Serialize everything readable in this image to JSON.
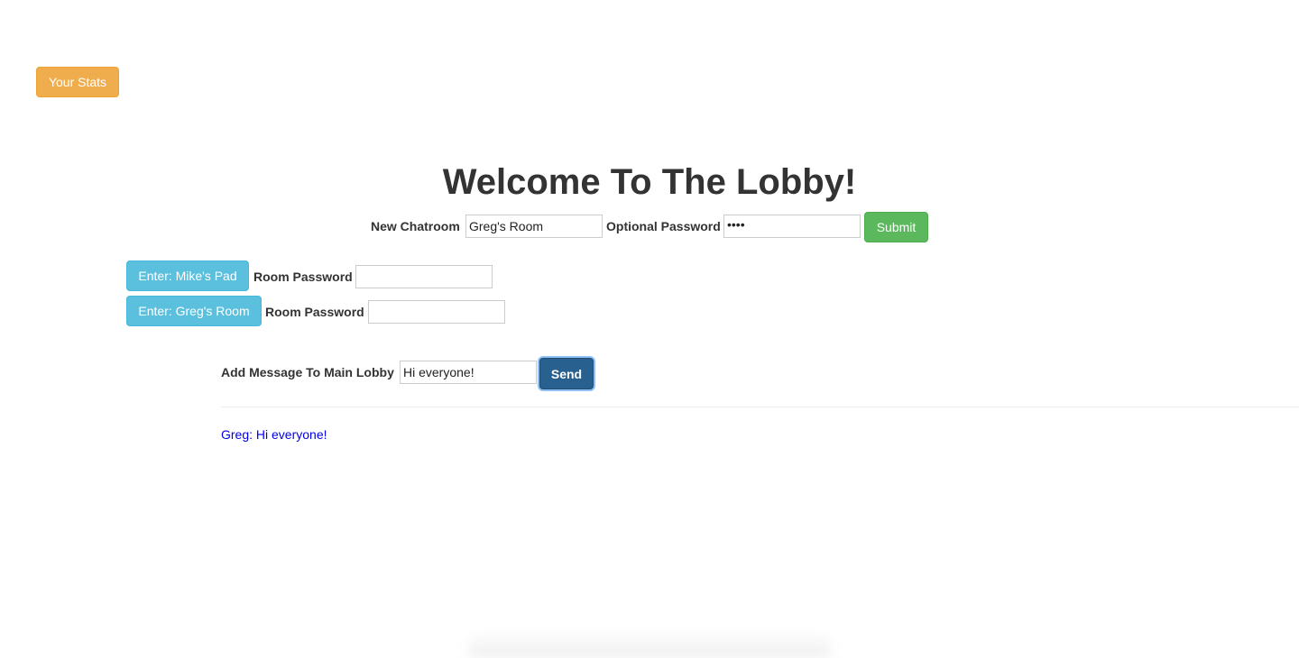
{
  "stats_button": "Your Stats",
  "title": "Welcome To The Lobby!",
  "new_room": {
    "label": "New Chatroom",
    "value": "Greg's Room",
    "password_label": "Optional Password",
    "password_value": "••••",
    "submit": "Submit"
  },
  "rooms": [
    {
      "enter": "Enter: Mike's Pad",
      "password_label": "Room Password",
      "password_value": ""
    },
    {
      "enter": "Enter: Greg's Room",
      "password_label": "Room Password",
      "password_value": ""
    }
  ],
  "message": {
    "label": "Add Message To Main Lobby",
    "value": "Hi everyone!",
    "send": "Send"
  },
  "messages": [
    "Greg: Hi everyone!"
  ],
  "colors": {
    "warning": "#f0ad4e",
    "info": "#5bc0de",
    "success": "#5cb85c",
    "primary": "#286090",
    "link": "#0000ee"
  }
}
